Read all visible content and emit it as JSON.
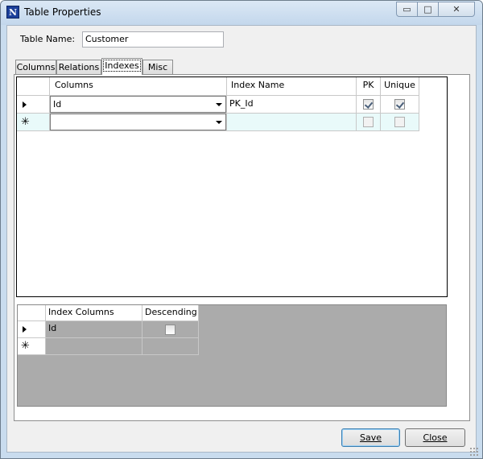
{
  "window": {
    "title": "Table Properties",
    "app_icon_letter": "N"
  },
  "caption_buttons": {
    "minimize": "▭",
    "maximize": "□",
    "close": "✕"
  },
  "form": {
    "table_name_label": "Table Name:",
    "table_name_value": "Customer"
  },
  "tabs": [
    {
      "label": "Columns",
      "active": false
    },
    {
      "label": "Relations",
      "active": false
    },
    {
      "label": "Indexes",
      "active": true
    },
    {
      "label": "Misc",
      "active": false
    }
  ],
  "indexes_grid": {
    "columns": [
      "Columns",
      "Index Name",
      "PK",
      "Unique"
    ],
    "rows": [
      {
        "column": "Id",
        "index_name": "PK_Id",
        "pk": true,
        "unique": true,
        "current": true
      },
      {
        "column": "",
        "index_name": "",
        "pk": false,
        "unique": false,
        "new_row": true
      }
    ]
  },
  "index_columns_grid": {
    "columns": [
      "Index Columns",
      "Descending"
    ],
    "rows": [
      {
        "column": "Id",
        "descending": false,
        "current": true
      },
      {
        "column": "",
        "new_row": true
      }
    ]
  },
  "buttons": {
    "save": "Save",
    "close": "Close"
  },
  "glyphs": {
    "current_row": "current-row-arrow",
    "new_row": "✳"
  }
}
